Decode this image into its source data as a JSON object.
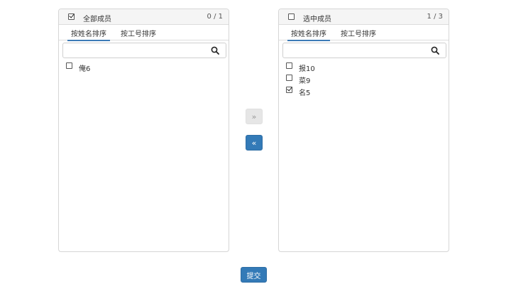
{
  "left_panel": {
    "header_label": "全部成员",
    "header_checked": true,
    "count": "0 / 1",
    "tabs": [
      "按姓名排序",
      "按工号排序"
    ],
    "active_tab": 0,
    "search": {
      "value": "",
      "placeholder": ""
    },
    "items": [
      {
        "label": "俺6",
        "checked": false
      }
    ]
  },
  "right_panel": {
    "header_label": "选中成员",
    "header_checked": false,
    "count": "1 / 3",
    "tabs": [
      "按姓名排序",
      "按工号排序"
    ],
    "active_tab": 0,
    "search": {
      "value": "",
      "placeholder": ""
    },
    "items": [
      {
        "label": "报10",
        "checked": false
      },
      {
        "label": "菜9",
        "checked": false
      },
      {
        "label": "名5",
        "checked": true
      }
    ]
  },
  "controls": {
    "move_right_label": "»",
    "move_left_label": "«",
    "move_right_enabled": false,
    "move_left_enabled": true,
    "submit_label": "提交"
  },
  "colors": {
    "primary": "#337ab7",
    "tab_underline": "#3c7bb7",
    "header_bg": "#f5f5f5",
    "disabled_button_bg": "#e6e6e6"
  },
  "icons": {
    "search": "magnifier-icon",
    "checkbox": "checkbox-icon"
  }
}
